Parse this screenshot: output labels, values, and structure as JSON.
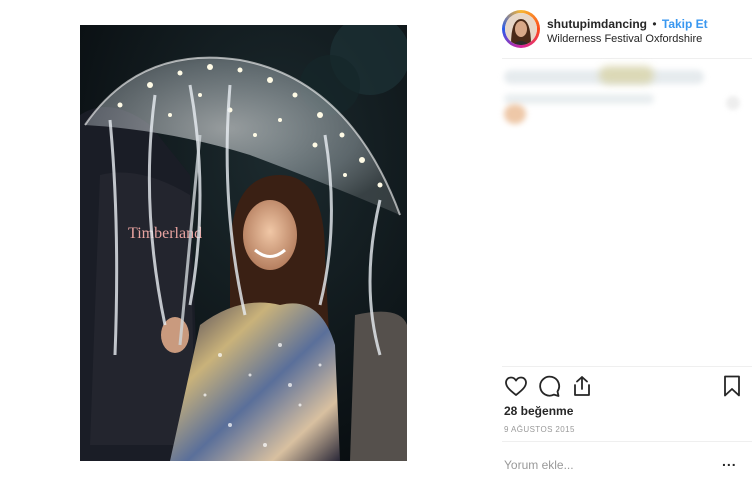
{
  "post": {
    "username": "shutupimdancing",
    "separator": "•",
    "follow_label": "Takip Et",
    "location": "Wilderness Festival Oxfordshire",
    "photo_shirt_text": "Timberland",
    "likes": "28 beğenme",
    "date": "9 AĞUSTOS 2015",
    "comment_placeholder": "Yorum ekle...",
    "more_label": "..."
  },
  "actions": {
    "like_icon": "heart-icon",
    "comment_icon": "comment-icon",
    "share_icon": "share-icon",
    "save_icon": "bookmark-icon"
  },
  "colors": {
    "follow": "#3897f0",
    "divider": "#efefef",
    "muted": "#999999"
  }
}
